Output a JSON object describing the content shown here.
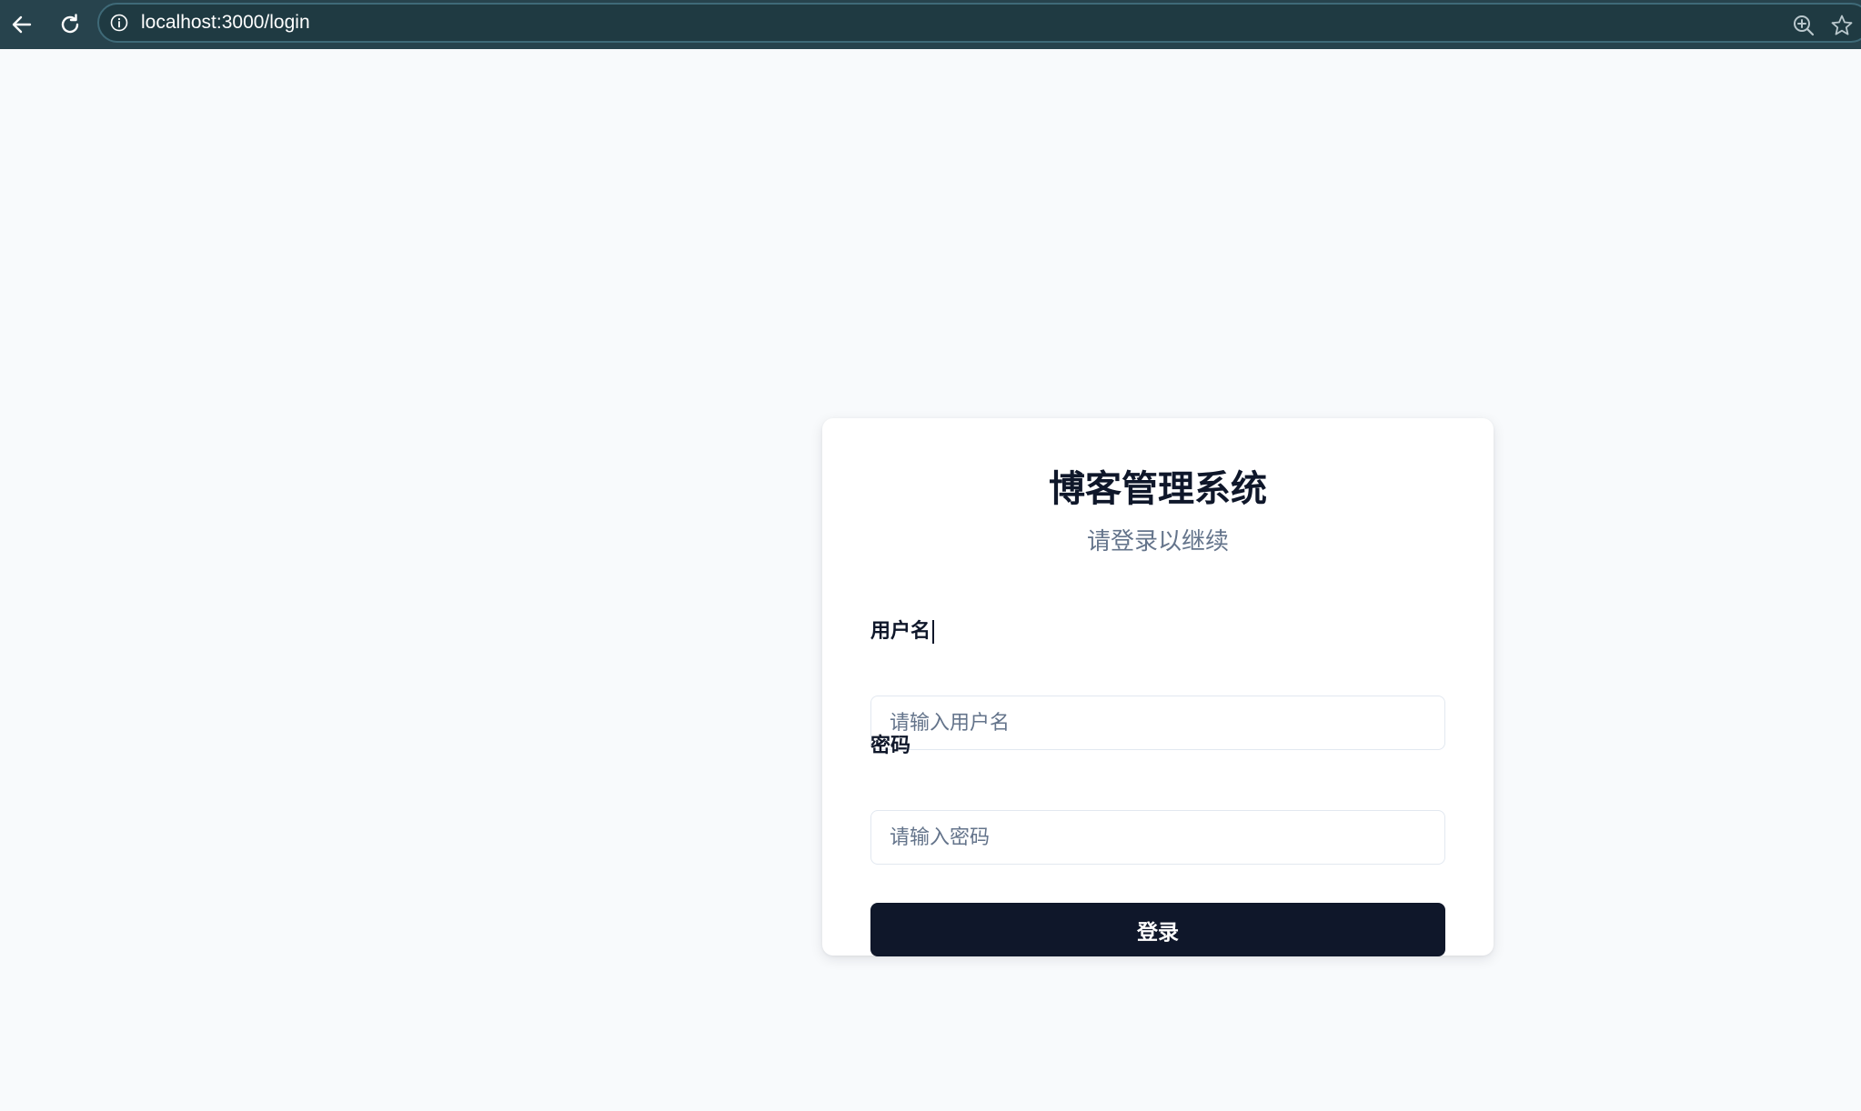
{
  "browser": {
    "url": "localhost:3000/login",
    "back_icon": "back-arrow-icon",
    "reload_icon": "reload-icon",
    "info_icon": "info-icon",
    "zoom_icon": "zoom-in-icon",
    "bookmark_icon": "star-icon"
  },
  "login": {
    "title": "博客管理系统",
    "subtitle": "请登录以继续",
    "username_label": "用户名",
    "username_placeholder": "请输入用户名",
    "password_label": "密码",
    "password_placeholder": "请输入密码",
    "submit_label": "登录"
  },
  "colors": {
    "browser_bar": "#27434d",
    "page_background": "#f8fafc",
    "primary_button": "#0f172a",
    "subtitle_text": "#64748b"
  }
}
